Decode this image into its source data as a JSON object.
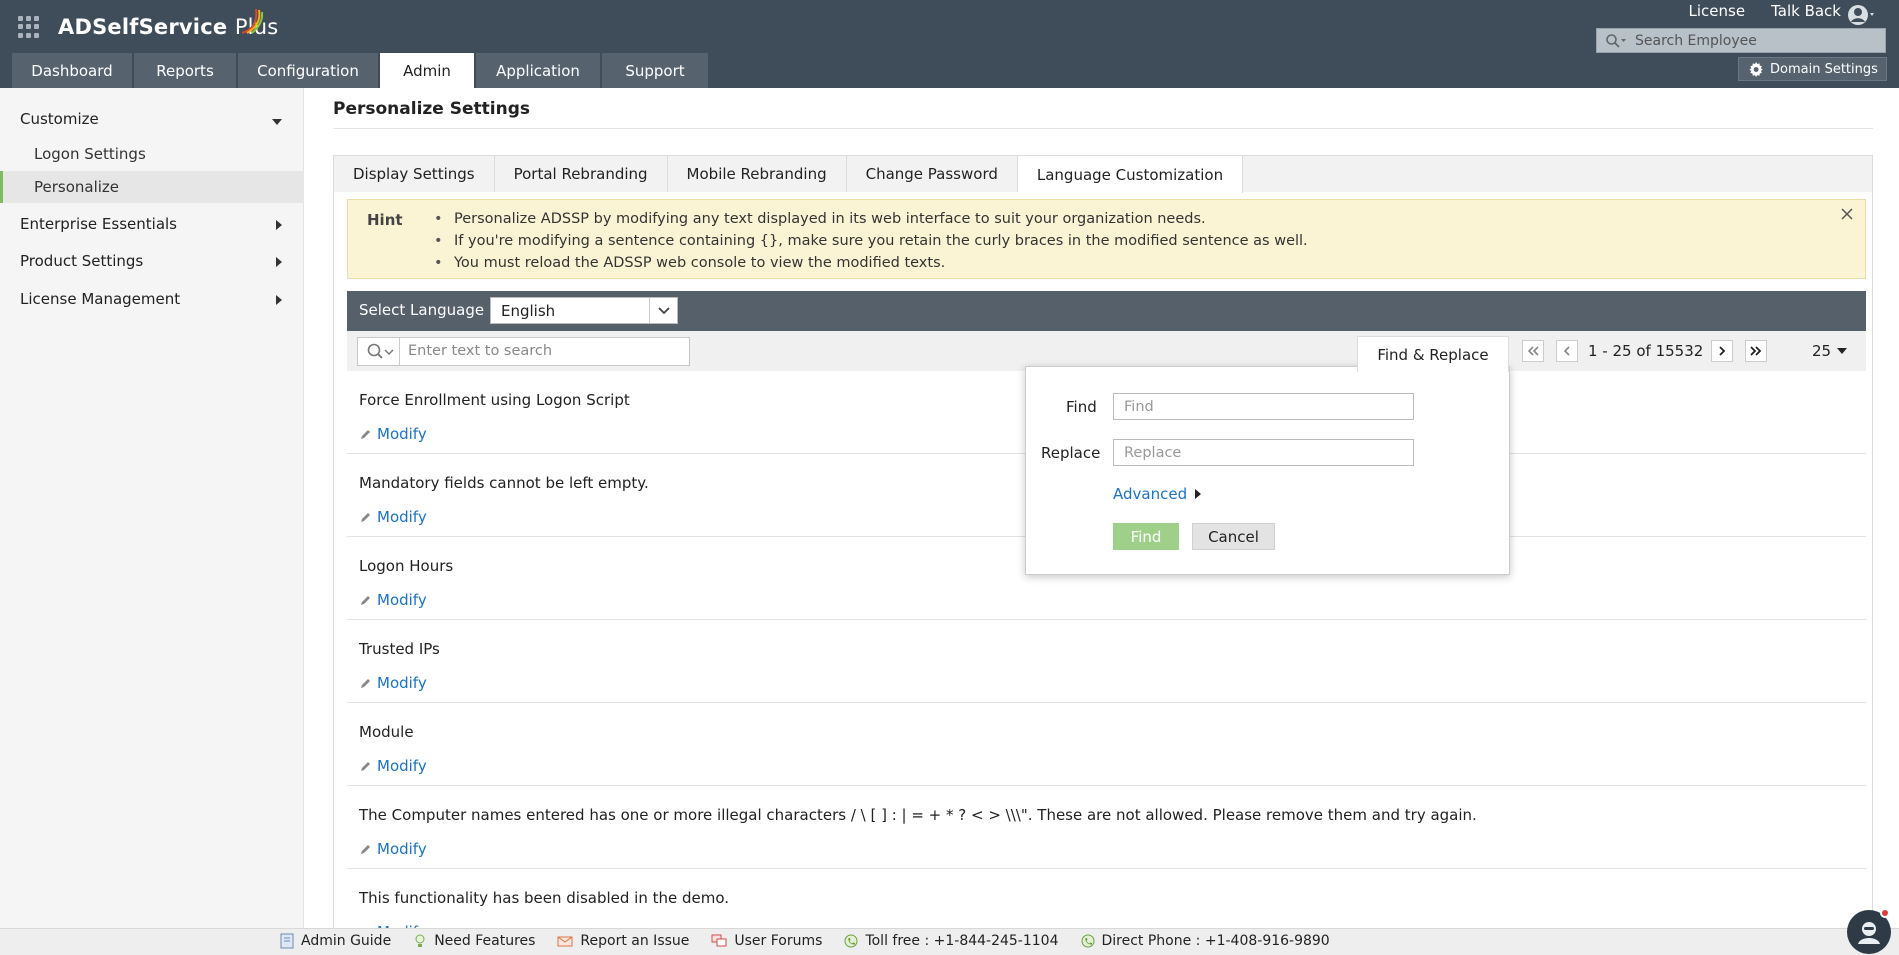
{
  "header": {
    "brand_name": "ADSelfService",
    "brand_plus": "Plus",
    "license_link": "License",
    "talkback_link": "Talk Back",
    "search_placeholder": "Search Employee",
    "domain_settings": "Domain Settings"
  },
  "nav": {
    "tabs": [
      {
        "label": "Dashboard"
      },
      {
        "label": "Reports"
      },
      {
        "label": "Configuration"
      },
      {
        "label": "Admin"
      },
      {
        "label": "Application"
      },
      {
        "label": "Support"
      }
    ],
    "active": "Admin"
  },
  "sidebar": {
    "customize": "Customize",
    "logon_settings": "Logon Settings",
    "personalize": "Personalize",
    "enterprise_essentials": "Enterprise Essentials",
    "product_settings": "Product Settings",
    "license_management": "License Management"
  },
  "main": {
    "title": "Personalize Settings",
    "tabs": [
      {
        "label": "Display Settings"
      },
      {
        "label": "Portal Rebranding"
      },
      {
        "label": "Mobile Rebranding"
      },
      {
        "label": "Change Password"
      },
      {
        "label": "Language Customization"
      }
    ],
    "active_tab": "Language Customization"
  },
  "hint": {
    "label": "Hint",
    "items": [
      "Personalize ADSSP by modifying any text displayed in its web interface to suit your organization needs.",
      "If you're modifying a sentence containing {}, make sure you retain the curly braces in the modified sentence as well.",
      "You must reload the ADSSP web console to view the modified texts."
    ]
  },
  "language": {
    "label": "Select Language",
    "selected": "English"
  },
  "toolbar": {
    "search_placeholder": "Enter text to search",
    "find_replace_tab": "Find & Replace",
    "pagination": "1 - 25 of 15532",
    "page_size": "25"
  },
  "rows": [
    {
      "text": "Force Enrollment using Logon Script",
      "action": "Modify"
    },
    {
      "text": "Mandatory fields cannot be left empty.",
      "action": "Modify"
    },
    {
      "text": "Logon Hours",
      "action": "Modify"
    },
    {
      "text": "Trusted IPs",
      "action": "Modify"
    },
    {
      "text": "Module",
      "action": "Modify"
    },
    {
      "text": "The Computer names entered has one or more illegal characters / \\ [ ] : | = + * ? < > \\\\\\\". These are not allowed. Please remove them and try again.",
      "action": "Modify"
    },
    {
      "text": "This functionality has been disabled in the demo.",
      "action": "Modify"
    }
  ],
  "popup": {
    "find_label": "Find",
    "find_placeholder": "Find",
    "replace_label": "Replace",
    "replace_placeholder": "Replace",
    "advanced": "Advanced",
    "find_button": "Find",
    "cancel_button": "Cancel"
  },
  "footer": {
    "items": [
      {
        "label": "Admin Guide"
      },
      {
        "label": "Need Features"
      },
      {
        "label": "Report an Issue"
      },
      {
        "label": "User Forums"
      },
      {
        "label": "Toll free : +1-844-245-1104"
      },
      {
        "label": "Direct Phone : +1-408-916-9890"
      }
    ]
  },
  "colors": {
    "header_bg": "#3f4c59",
    "link_blue": "#1a73c8",
    "find_button_green": "#9fd08a",
    "hint_bg": "#fbf4d4",
    "sidebar_active_accent": "#7dbb5c"
  }
}
